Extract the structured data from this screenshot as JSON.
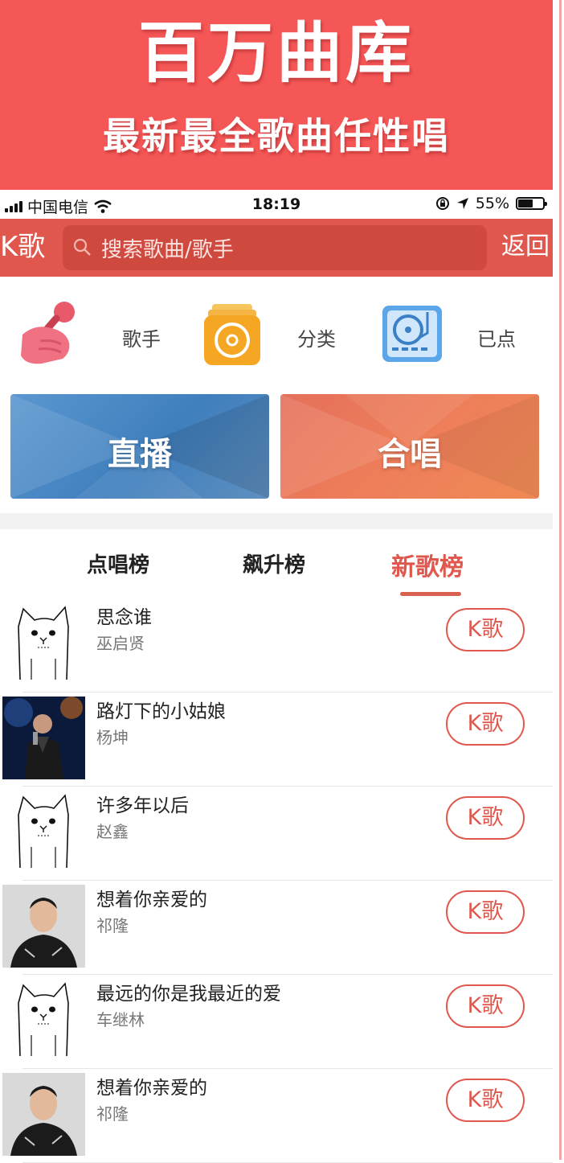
{
  "banner": {
    "title": "百万曲库",
    "subtitle": "最新最全歌曲任性唱"
  },
  "status_bar": {
    "carrier": "中国电信",
    "time": "18:19",
    "battery": "55%"
  },
  "navbar": {
    "title": "K歌",
    "search_placeholder": "搜索歌曲/歌手",
    "back_label": "返回"
  },
  "quick_entries": [
    {
      "label": "歌手",
      "icon": "microphone-icon"
    },
    {
      "label": "分类",
      "icon": "category-disc-icon"
    },
    {
      "label": "已点",
      "icon": "turntable-icon"
    }
  ],
  "cards": [
    {
      "label": "直播",
      "color": "#4a8ac4"
    },
    {
      "label": "合唱",
      "color": "#ec7a58"
    }
  ],
  "tabs": [
    {
      "label": "点唱榜"
    },
    {
      "label": "飙升榜"
    },
    {
      "label": "新歌榜",
      "active": true
    }
  ],
  "songs": [
    {
      "title": "思念谁",
      "artist": "巫启贤",
      "thumb": "cat-avatar",
      "button": "K歌"
    },
    {
      "title": "路灯下的小姑娘",
      "artist": "杨坤",
      "thumb": "singer-photo-stage",
      "button": "K歌"
    },
    {
      "title": "许多年以后",
      "artist": "赵鑫",
      "thumb": "cat-avatar",
      "button": "K歌"
    },
    {
      "title": "想着你亲爱的",
      "artist": "祁隆",
      "thumb": "singer-photo-portrait",
      "button": "K歌"
    },
    {
      "title": "最远的你是我最近的爱",
      "artist": "车继林",
      "thumb": "cat-avatar",
      "button": "K歌"
    },
    {
      "title": "想着你亲爱的",
      "artist": "祁隆",
      "thumb": "singer-photo-portrait",
      "button": "K歌"
    }
  ],
  "colors": {
    "accent": "#e0584d",
    "banner": "#f55656"
  }
}
